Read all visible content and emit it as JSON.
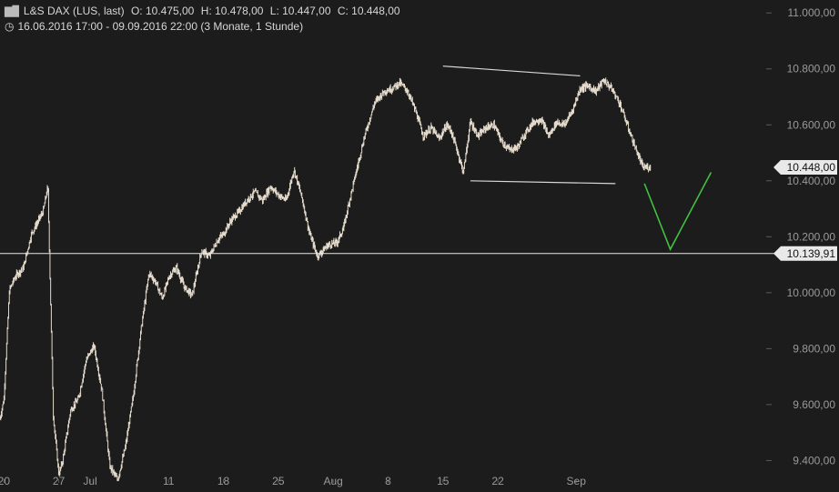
{
  "header": {
    "instrument": "L&S DAX (LUS, last)",
    "open": "O: 10.475,00",
    "high": "H: 10.478,00",
    "low": "L: 10.447,00",
    "close": "C: 10.448,00",
    "period": "16.06.2016 17:00 - 09.09.2016 22:00 (3 Monate, 1 Stunde)",
    "logo_icon": "candlestick-logo-icon",
    "clock_icon": "clock-icon"
  },
  "colors": {
    "background": "#1d1c1c",
    "candle": "#e6dccd",
    "trendline": "#d9d9d9",
    "horizontal_line": "#e8e8e8",
    "projection": "#3fc23f",
    "axis_text": "#9a9a9a",
    "price_label_bg": "#e9e9e9"
  },
  "chart_data": {
    "type": "candlestick",
    "interval": "1 Stunde",
    "y_ticks": [
      11000,
      10800,
      10600,
      10400,
      10200,
      10000,
      9800,
      9600,
      9400
    ],
    "y_tick_labels": [
      "11.000,00",
      "10.800,00",
      "10.600,00",
      "10.400,00",
      "10.200,00",
      "10.000,00",
      "9.800,00",
      "9.600,00",
      "9.400,00"
    ],
    "ylim": [
      9320,
      11030
    ],
    "x_ticks": [
      "20",
      "27",
      "Jul",
      "11",
      "18",
      "25",
      "Aug",
      "8",
      "15",
      "22",
      "Sep"
    ],
    "x_tick_days": [
      4,
      11,
      15,
      25,
      32,
      39,
      46,
      53,
      60,
      67,
      77
    ],
    "xlim_days": [
      3.5,
      101
    ],
    "close_path_days": [
      3.5,
      4,
      4.7,
      5.5,
      6.5,
      7.5,
      9,
      9.6,
      10.3,
      11,
      11.5,
      12.5,
      13.5,
      14.5,
      15.5,
      16.5,
      17.5,
      18.5,
      19.5,
      20.5,
      21.5,
      22.5,
      23.3,
      24.2,
      25.1,
      26,
      27,
      28,
      29.2,
      30.2,
      31.3,
      32,
      33,
      34,
      35,
      36,
      37,
      38,
      39,
      40,
      41,
      42,
      43,
      44,
      45.3,
      46.5,
      47.3,
      48,
      49,
      50,
      51.3,
      52.5,
      53.5,
      54.5,
      55.5,
      56.5,
      57.5,
      58.5,
      59.5,
      60.5,
      61,
      61.8,
      62.6,
      63.5,
      64.5,
      65.5,
      66.5,
      67.5,
      68.5,
      69.5,
      70.5,
      71.5,
      72.5,
      73.5,
      74.5,
      75.5,
      76.5,
      77.5,
      78.5,
      79.5,
      80.5,
      81.5,
      82.5,
      83.5,
      84.5,
      85.5,
      86.5
    ],
    "close_path_values": [
      9550,
      9620,
      10010,
      10060,
      10090,
      10210,
      10290,
      10380,
      9560,
      9350,
      9400,
      9580,
      9620,
      9760,
      9810,
      9650,
      9380,
      9330,
      9450,
      9630,
      9870,
      10070,
      10040,
      9980,
      10060,
      10090,
      10020,
      9990,
      10150,
      10130,
      10190,
      10210,
      10260,
      10290,
      10330,
      10360,
      10330,
      10380,
      10350,
      10330,
      10440,
      10340,
      10210,
      10130,
      10170,
      10180,
      10230,
      10320,
      10440,
      10560,
      10680,
      10720,
      10730,
      10750,
      10720,
      10650,
      10560,
      10590,
      10550,
      10600,
      10580,
      10510,
      10430,
      10610,
      10560,
      10590,
      10600,
      10540,
      10510,
      10520,
      10570,
      10610,
      10620,
      10560,
      10610,
      10600,
      10650,
      10730,
      10740,
      10720,
      10760,
      10730,
      10680,
      10600,
      10520,
      10448,
      10448
    ],
    "last_price": 10448,
    "last_price_label": "10.448,00",
    "support_line": {
      "value": 10139.91,
      "label": "10.139,91"
    },
    "channel_upper": [
      [
        60,
        10810
      ],
      [
        77.5,
        10775
      ]
    ],
    "channel_lower": [
      [
        63.5,
        10400
      ],
      [
        82,
        10390
      ]
    ],
    "projection": [
      [
        85.7,
        10390
      ],
      [
        89,
        10155
      ],
      [
        94.2,
        10430
      ]
    ]
  }
}
